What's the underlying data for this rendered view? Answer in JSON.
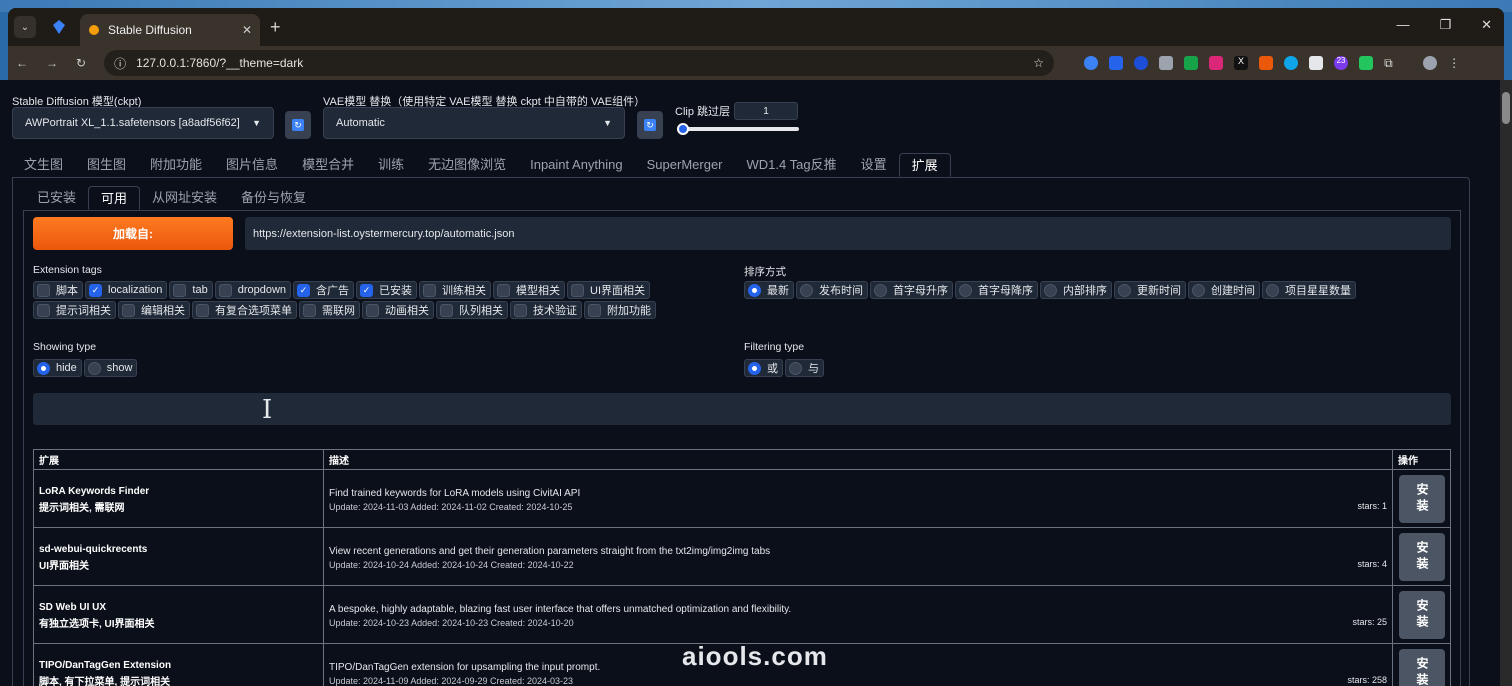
{
  "browser": {
    "tab_title": "Stable Diffusion",
    "url": "127.0.0.1:7860/?__theme=dark",
    "ext_badge": "23"
  },
  "top": {
    "ckpt_label": "Stable Diffusion 模型(ckpt)",
    "ckpt_value": "AWPortrait XL_1.1.safetensors [a8adf56f62]",
    "vae_label": "VAE模型 替换（使用特定 VAE模型 替换 ckpt 中自带的 VAE组件）",
    "vae_value": "Automatic",
    "clip_label": "Clip 跳过层",
    "clip_value": "1"
  },
  "main_tabs": [
    "文生图",
    "图生图",
    "附加功能",
    "图片信息",
    "模型合并",
    "训练",
    "无边图像浏览",
    "Inpaint Anything",
    "SuperMerger",
    "WD1.4 Tag反推",
    "设置",
    "扩展"
  ],
  "sub_tabs": [
    "已安装",
    "可用",
    "从网址安装",
    "备份与恢复"
  ],
  "load": {
    "button": "加载自:",
    "url": "https://extension-list.oystermercury.top/automatic.json"
  },
  "tags": {
    "label": "Extension tags",
    "items": [
      {
        "label": "脚本",
        "checked": false
      },
      {
        "label": "localization",
        "checked": true
      },
      {
        "label": "tab",
        "checked": false
      },
      {
        "label": "dropdown",
        "checked": false
      },
      {
        "label": "含广告",
        "checked": true
      },
      {
        "label": "已安装",
        "checked": true
      },
      {
        "label": "训练相关",
        "checked": false
      },
      {
        "label": "模型相关",
        "checked": false
      },
      {
        "label": "UI界面相关",
        "checked": false
      },
      {
        "label": "提示词相关",
        "checked": false
      },
      {
        "label": "编辑相关",
        "checked": false
      },
      {
        "label": "有复合选项菜单",
        "checked": false
      },
      {
        "label": "需联网",
        "checked": false
      },
      {
        "label": "动画相关",
        "checked": false
      },
      {
        "label": "队列相关",
        "checked": false
      },
      {
        "label": "技术验证",
        "checked": false
      },
      {
        "label": "附加功能",
        "checked": false
      }
    ]
  },
  "sort": {
    "label": "排序方式",
    "items": [
      {
        "label": "最新",
        "selected": true
      },
      {
        "label": "发布时间",
        "selected": false
      },
      {
        "label": "首字母升序",
        "selected": false
      },
      {
        "label": "首字母降序",
        "selected": false
      },
      {
        "label": "内部排序",
        "selected": false
      },
      {
        "label": "更新时间",
        "selected": false
      },
      {
        "label": "创建时间",
        "selected": false
      },
      {
        "label": "项目星星数量",
        "selected": false
      }
    ]
  },
  "showing": {
    "label": "Showing type",
    "items": [
      {
        "label": "hide",
        "selected": true
      },
      {
        "label": "show",
        "selected": false
      }
    ]
  },
  "filtering": {
    "label": "Filtering type",
    "items": [
      {
        "label": "或",
        "selected": true
      },
      {
        "label": "与",
        "selected": false
      }
    ]
  },
  "table": {
    "headers": [
      "扩展",
      "描述",
      "操作"
    ],
    "install_label": "安装",
    "rows": [
      {
        "name": "LoRA Keywords Finder",
        "tags": "提示词相关, 需联网",
        "desc": "Find trained keywords for LoRA models using CivitAI API",
        "dates": "Update: 2024-11-03 Added: 2024-11-02 Created: 2024-10-25",
        "stars": "stars: 1"
      },
      {
        "name": "sd-webui-quickrecents",
        "tags": "UI界面相关",
        "desc": "View recent generations and get their generation parameters straight from the txt2img/img2img tabs",
        "dates": "Update: 2024-10-24 Added: 2024-10-24 Created: 2024-10-22",
        "stars": "stars: 4"
      },
      {
        "name": "SD Web UI UX",
        "tags": "有独立选项卡, UI界面相关",
        "desc": "A bespoke, highly adaptable, blazing fast user interface that offers unmatched optimization and flexibility.",
        "dates": "Update: 2024-10-23 Added: 2024-10-23 Created: 2024-10-20",
        "stars": "stars: 25"
      },
      {
        "name": "TIPO/DanTagGen Extension",
        "tags": "脚本, 有下拉菜单, 提示词相关",
        "desc": "TIPO/DanTagGen extension for upsampling the input prompt.",
        "dates": "Update: 2024-11-09 Added: 2024-09-29 Created: 2024-03-23",
        "stars": "stars: 258"
      }
    ]
  },
  "watermark": "aiools.com"
}
